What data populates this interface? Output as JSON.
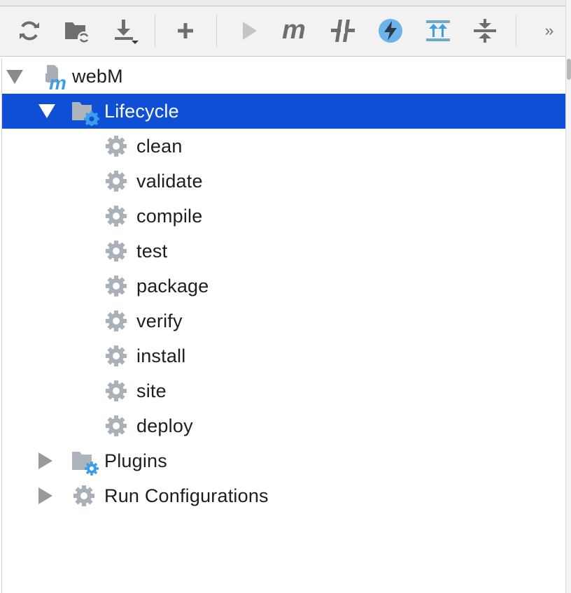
{
  "toolbar": {
    "buttons": [
      {
        "name": "reimport-all-icon"
      },
      {
        "name": "generate-sources-icon"
      },
      {
        "name": "download-sources-icon"
      },
      {
        "name": "add-project-icon"
      },
      {
        "name": "run-goal-icon"
      },
      {
        "name": "execute-maven-goal-icon"
      },
      {
        "name": "toggle-offline-icon"
      },
      {
        "name": "skip-tests-icon"
      },
      {
        "name": "show-dependencies-icon"
      },
      {
        "name": "collapse-all-icon"
      },
      {
        "name": "more-icon"
      }
    ],
    "more_glyph": "››"
  },
  "tree": {
    "root": {
      "label": "webM",
      "expanded": true
    },
    "lifecycle": {
      "label": "Lifecycle",
      "expanded": true,
      "selected": true
    },
    "goals": [
      "clean",
      "validate",
      "compile",
      "test",
      "package",
      "verify",
      "install",
      "site",
      "deploy"
    ],
    "plugins": {
      "label": "Plugins",
      "expanded": false
    },
    "run_configurations": {
      "label": "Run Configurations",
      "expanded": false
    }
  },
  "colors": {
    "selection": "#0f4fd6",
    "icon_gray": "#6e6e6e",
    "icon_blue": "#3c9ee8",
    "gear_gray": "#a9b0b7"
  }
}
